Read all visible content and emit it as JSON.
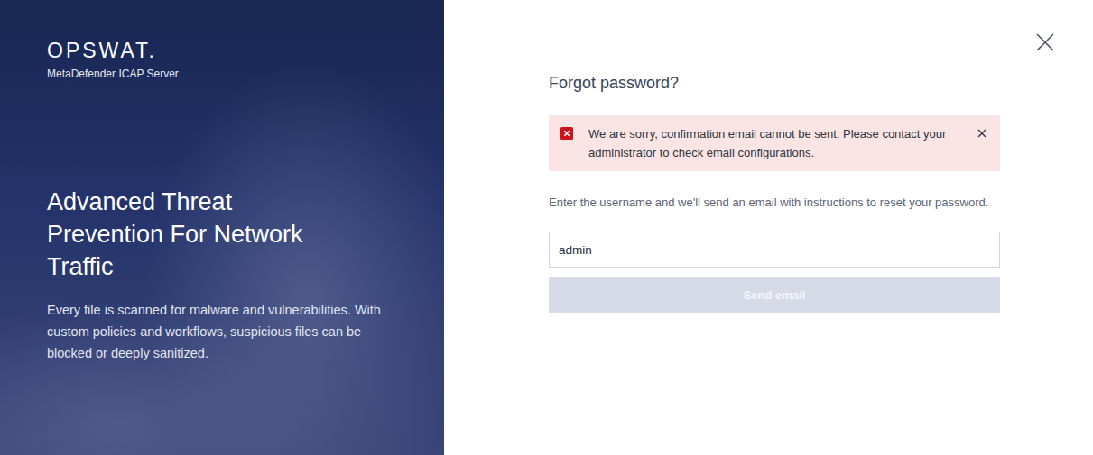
{
  "logo": {
    "brand": "OPSWAT.",
    "product": "MetaDefender ICAP Server"
  },
  "hero": {
    "headline": "Advanced Threat Prevention For Network Traffic",
    "body": "Every file is scanned for malware and vulnerabilities. With custom policies and workflows, suspicious files can be blocked or deeply sanitized."
  },
  "form": {
    "title": "Forgot password?",
    "alert": {
      "message": "We are sorry, confirmation email cannot be sent. Please contact your administrator to check email configurations.",
      "dismissible": true
    },
    "instructions": "Enter the username and we'll send an email with instructions to reset your password.",
    "username": {
      "value": "admin"
    },
    "submit": {
      "label": "Send email",
      "disabled": true
    }
  }
}
